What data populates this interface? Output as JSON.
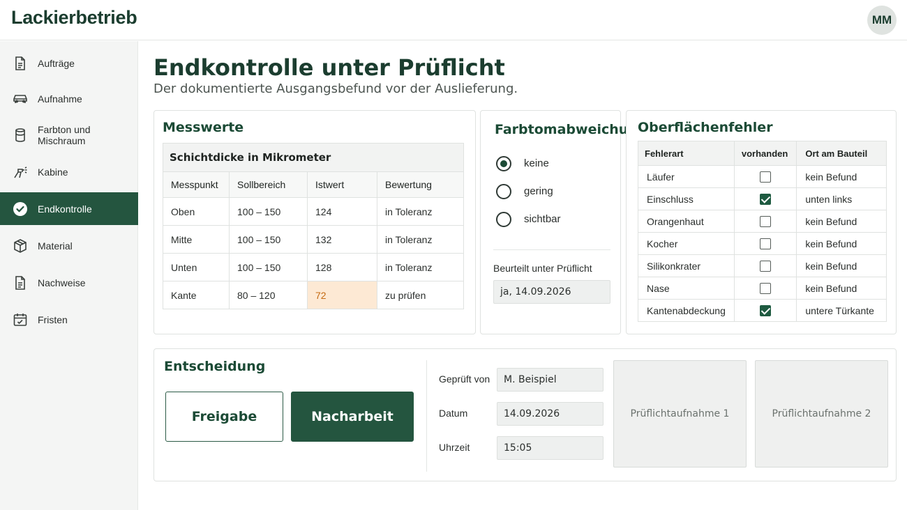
{
  "app": {
    "brand": "Lackierbetrieb",
    "user_initials": "MM"
  },
  "sidebar": {
    "items": [
      {
        "label": "Aufträge",
        "icon": "document-icon",
        "active": false
      },
      {
        "label": "Aufnahme",
        "icon": "car-icon",
        "active": false
      },
      {
        "label": "Farbton und Mischraum",
        "icon": "can-icon",
        "active": false
      },
      {
        "label": "Kabine",
        "icon": "spray-gun-icon",
        "active": false
      },
      {
        "label": "Endkontrolle",
        "icon": "check-circle-icon",
        "active": true
      },
      {
        "label": "Material",
        "icon": "box-icon",
        "active": false
      },
      {
        "label": "Nachweise",
        "icon": "document-icon",
        "active": false
      },
      {
        "label": "Fristen",
        "icon": "calendar-icon",
        "active": false
      }
    ]
  },
  "page": {
    "title": "Endkontrolle unter Prüflicht",
    "subtitle": "Der dokumentierte Ausgangsbefund vor der Auslieferung."
  },
  "messwerte": {
    "title": "Messwerte",
    "caption": "Schichtdicke in Mikrometer",
    "headers": [
      "Messpunkt",
      "Sollbereich",
      "Istwert",
      "Bewertung"
    ],
    "rows": [
      {
        "punkt": "Oben",
        "soll": "100 – 150",
        "ist": "124",
        "bewertung": "in Toleranz",
        "status": "ok"
      },
      {
        "punkt": "Mitte",
        "soll": "100 – 150",
        "ist": "132",
        "bewertung": "in Toleranz",
        "status": "ok"
      },
      {
        "punkt": "Unten",
        "soll": "100 – 150",
        "ist": "128",
        "bewertung": "in Toleranz",
        "status": "ok"
      },
      {
        "punkt": "Kante",
        "soll": "80 – 120",
        "ist": "72",
        "bewertung": "zu prüfen",
        "status": "warn"
      }
    ]
  },
  "farbton": {
    "title": "Farbtomabweichung",
    "options": [
      {
        "label": "keine",
        "checked": true
      },
      {
        "label": "gering",
        "checked": false
      },
      {
        "label": "sichtbar",
        "checked": false
      }
    ],
    "beurteilt_label": "Beurteilt unter Prüflicht",
    "beurteilt_value": "ja, 14.09.2026"
  },
  "oberflaeche": {
    "title": "Oberflächenfehler",
    "headers": [
      "Fehlerart",
      "vorhanden",
      "Ort am Bauteil"
    ],
    "rows": [
      {
        "art": "Läufer",
        "vorhanden": false,
        "ort": "kein Befund"
      },
      {
        "art": "Einschluss",
        "vorhanden": true,
        "ort": "unten links"
      },
      {
        "art": "Orangenhaut",
        "vorhanden": false,
        "ort": "kein Befund"
      },
      {
        "art": "Kocher",
        "vorhanden": false,
        "ort": "kein Befund"
      },
      {
        "art": "Silikonkrater",
        "vorhanden": false,
        "ort": "kein Befund"
      },
      {
        "art": "Nase",
        "vorhanden": false,
        "ort": "kein Befund"
      },
      {
        "art": "Kantenabdeckung",
        "vorhanden": true,
        "ort": "untere Türkante"
      }
    ]
  },
  "entscheidung": {
    "title": "Entscheidung",
    "freigabe_label": "Freigabe",
    "nacharbeit_label": "Nacharbeit",
    "geprueft_label": "Geprüft von",
    "geprueft_value": "M. Beispiel",
    "datum_label": "Datum",
    "datum_value": "14.09.2026",
    "uhrzeit_label": "Uhrzeit",
    "uhrzeit_value": "15:05",
    "photo1_label": "Prüflichtaufnahme 1",
    "photo2_label": "Prüflichtaufnahme 2"
  },
  "colors": {
    "primary": "#24553f",
    "title": "#1b3d2f",
    "ok": "#1f6b3e",
    "warn": "#c0560e",
    "warn_bg": "#fde9d4"
  }
}
